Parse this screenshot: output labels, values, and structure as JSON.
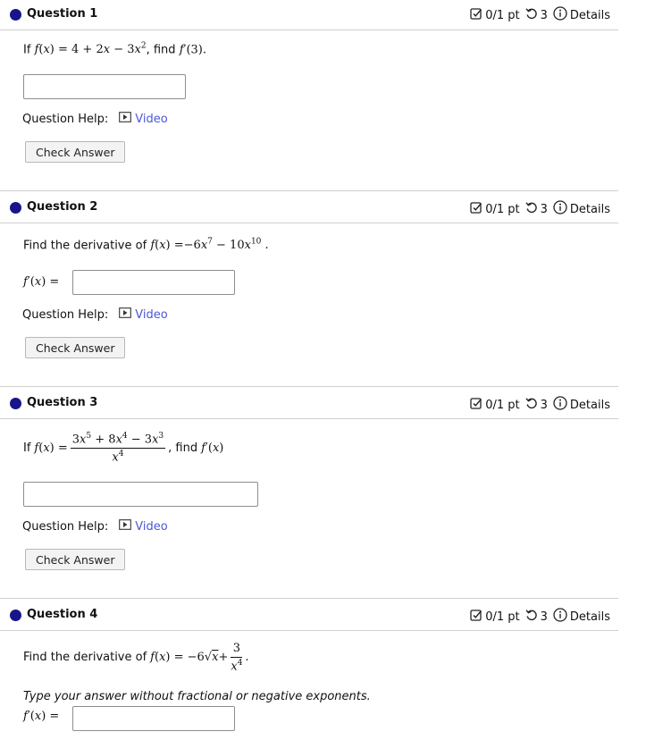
{
  "questions": [
    {
      "title": "Question 1",
      "score": "0/1 pt",
      "attempts": "3",
      "details": "Details",
      "help_label": "Question Help:",
      "video_label": "Video",
      "check_label": "Check Answer",
      "prompt_prefix": "If",
      "prompt_mid": ", find"
    },
    {
      "title": "Question 2",
      "score": "0/1 pt",
      "attempts": "3",
      "details": "Details",
      "help_label": "Question Help:",
      "video_label": "Video",
      "check_label": "Check Answer",
      "prompt_prefix": "Find the derivative of"
    },
    {
      "title": "Question 3",
      "score": "0/1 pt",
      "attempts": "3",
      "details": "Details",
      "help_label": "Question Help:",
      "video_label": "Video",
      "check_label": "Check Answer",
      "prompt_prefix": "If",
      "prompt_mid": ", find"
    },
    {
      "title": "Question 4",
      "score": "0/1 pt",
      "attempts": "3",
      "details": "Details",
      "prompt_prefix": "Find the derivative of",
      "note": "Type your answer without fractional or negative exponents."
    }
  ],
  "colors": {
    "accent_dot": "#16168a",
    "link": "#4a58d8",
    "border": "#cfcfcf"
  }
}
